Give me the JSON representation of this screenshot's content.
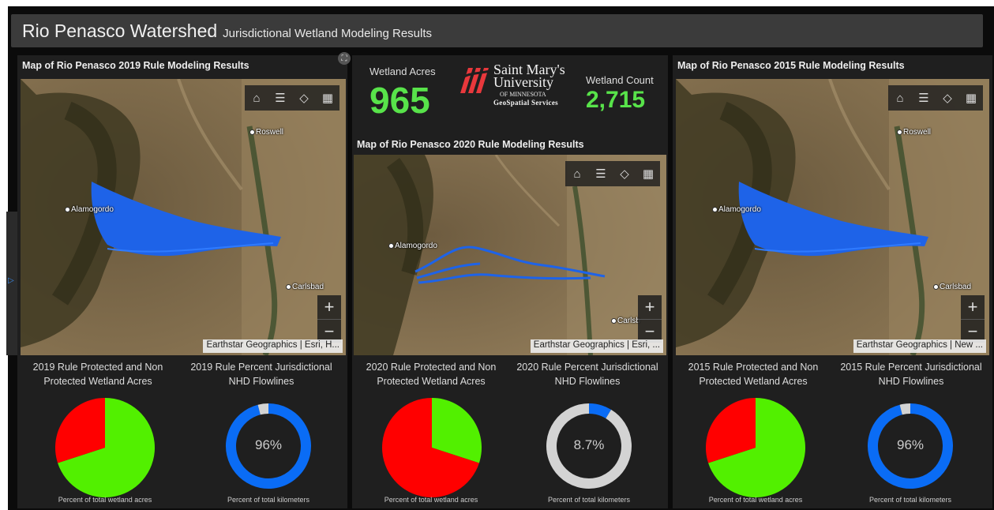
{
  "header": {
    "title": "Rio Penasco Watershed",
    "subtitle": "Jurisdictional Wetland Modeling Results"
  },
  "icons": {
    "home": "home-icon",
    "legend": "legend-list-icon",
    "layers": "layers-icon",
    "basemap": "basemap-gallery-icon",
    "expand": "expand-icon",
    "side": "chevron-right-icon"
  },
  "colors": {
    "protected": "#52f000",
    "non_protected": "#ff0000",
    "ring_fill": "#0a6cf5",
    "ring_track": "#d3d3d3",
    "metric": "#58e34a",
    "flowlines": "#1e63e8"
  },
  "map_ui": {
    "zoom_in": "+",
    "zoom_out": "−"
  },
  "center": {
    "acres_label": "Wetland Acres",
    "acres_value": "965",
    "count_label": "Wetland Count",
    "count_value": "2,715",
    "logo": {
      "line1": "Saint Mary's",
      "line2": "University",
      "line3": "OF MINNESOTA",
      "line4": "GeoSpatial Services"
    }
  },
  "panels": [
    {
      "map_title": "Map of Rio Penasco 2019 Rule Modeling Results",
      "attribution": "Earthstar Geographics | Esri, H...",
      "cities": [
        "Roswell",
        "Alamogordo",
        "Carlsbad"
      ],
      "pie_title": "2019 Rule Protected and Non Protected Wetland Acres",
      "pie_caption": "Percent of total wetland acres",
      "ring_title": "2019 Rule Percent Jurisdictional NHD Flowlines",
      "ring_label": "96%",
      "ring_caption": "Percent of total kilometers"
    },
    {
      "map_title": "Map of Rio Penasco 2020 Rule Modeling Results",
      "attribution": "Earthstar Geographics | Esri, ...",
      "cities": [
        "Alamogordo",
        "Carlsb"
      ],
      "pie_title": "2020 Rule Protected and Non Protected Wetland Acres",
      "pie_caption": "Percent of total wetland acres",
      "ring_title": "2020 Rule Percent Jurisdictional NHD Flowlines",
      "ring_label": "8.7%",
      "ring_caption": "Percent of total kilometers"
    },
    {
      "map_title": "Map of Rio Penasco 2015 Rule Modeling Results",
      "attribution": "Earthstar Geographics | New ...",
      "cities": [
        "Roswell",
        "Alamogordo",
        "Carlsbad"
      ],
      "pie_title": "2015 Rule Protected and Non Protected Wetland Acres",
      "pie_caption": "Percent of total wetland acres",
      "ring_title": "2015 Rule Percent Jurisdictional NHD Flowlines",
      "ring_label": "96%",
      "ring_caption": "Percent of total kilometers"
    }
  ],
  "chart_data": [
    {
      "type": "pie",
      "series": [
        {
          "values": [
            0.7,
            0.3
          ]
        }
      ],
      "colors": [
        "#52f000",
        "#ff0000"
      ]
    },
    {
      "type": "pie",
      "series": [
        {
          "values": [
            0.3,
            0.7
          ]
        }
      ],
      "colors": [
        "#52f000",
        "#ff0000"
      ]
    },
    {
      "type": "pie",
      "series": [
        {
          "values": [
            0.7,
            0.3
          ]
        }
      ],
      "colors": [
        "#52f000",
        "#ff0000"
      ]
    },
    {
      "type": "pie",
      "series": [
        {
          "values": [
            0.96,
            0.04
          ]
        }
      ],
      "colors": [
        "#0a6cf5",
        "#d3d3d3"
      ],
      "center_label": "96%"
    },
    {
      "type": "pie",
      "series": [
        {
          "values": [
            0.087,
            0.913
          ]
        }
      ],
      "colors": [
        "#0a6cf5",
        "#d3d3d3"
      ],
      "center_label": "8.7%"
    },
    {
      "type": "pie",
      "series": [
        {
          "values": [
            0.96,
            0.04
          ]
        }
      ],
      "colors": [
        "#0a6cf5",
        "#d3d3d3"
      ],
      "center_label": "96%"
    }
  ]
}
